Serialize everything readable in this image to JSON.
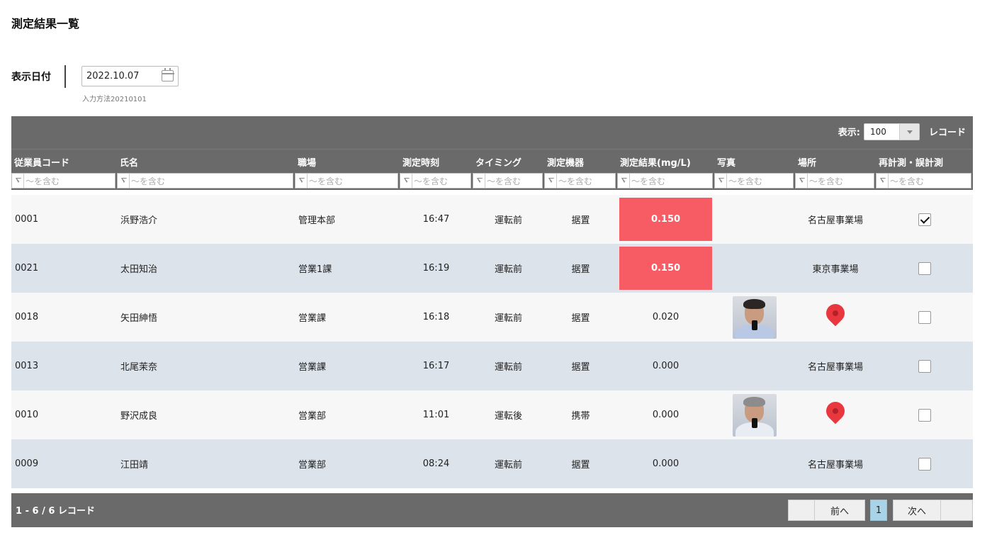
{
  "page": {
    "title": "測定結果一覧"
  },
  "date_filter": {
    "label": "表示日付",
    "value": "2022.10.07",
    "hint": "入力方法20210101"
  },
  "toolbar": {
    "pagesize_label": "表示:",
    "pagesize_value": "100",
    "pagesize_suffix": "レコード"
  },
  "columns": [
    "従業員コード",
    "氏名",
    "職場",
    "測定時刻",
    "タイミング",
    "測定機器",
    "測定結果(mg/L)",
    "写真",
    "場所",
    "再計測・誤計測"
  ],
  "filter_placeholder": "〜を含む",
  "rows": [
    {
      "code": "0001",
      "name": "浜野浩介",
      "workplace": "管理本部",
      "time": "16:47",
      "timing": "運転前",
      "device": "据置",
      "result": "0.150",
      "result_alert": true,
      "photo": null,
      "location": "名古屋事業場",
      "location_icon": null,
      "recheck": true
    },
    {
      "code": "0021",
      "name": "太田知治",
      "workplace": "営業1課",
      "time": "16:19",
      "timing": "運転前",
      "device": "据置",
      "result": "0.150",
      "result_alert": true,
      "photo": null,
      "location": "東京事業場",
      "location_icon": null,
      "recheck": false
    },
    {
      "code": "0018",
      "name": "矢田紳悟",
      "workplace": "営業課",
      "time": "16:18",
      "timing": "運転前",
      "device": "据置",
      "result": "0.020",
      "result_alert": false,
      "photo": "employee-photo-dark-hair",
      "location": null,
      "location_icon": "map-pin-icon",
      "recheck": false
    },
    {
      "code": "0013",
      "name": "北尾茉奈",
      "workplace": "営業課",
      "time": "16:17",
      "timing": "運転前",
      "device": "据置",
      "result": "0.000",
      "result_alert": false,
      "photo": null,
      "location": "名古屋事業場",
      "location_icon": null,
      "recheck": false
    },
    {
      "code": "0010",
      "name": "野沢成良",
      "workplace": "営業部",
      "time": "11:01",
      "timing": "運転後",
      "device": "携帯",
      "result": "0.000",
      "result_alert": false,
      "photo": "employee-photo-grey-hair",
      "location": null,
      "location_icon": "map-pin-icon",
      "recheck": false
    },
    {
      "code": "0009",
      "name": "江田靖",
      "workplace": "営業部",
      "time": "08:24",
      "timing": "運転前",
      "device": "据置",
      "result": "0.000",
      "result_alert": false,
      "photo": null,
      "location": "名古屋事業場",
      "location_icon": null,
      "recheck": false
    }
  ],
  "footer": {
    "record_count": "1 - 6 / 6 レコード",
    "prev_label": "前へ",
    "current_page": "1",
    "next_label": "次へ"
  },
  "colors": {
    "header_bg": "#6a6a6a",
    "row_even_bg": "#dde3ea",
    "alert_bg": "#f75c64",
    "pin": "#e8373e",
    "current_page_bg": "#a9d4e8"
  }
}
